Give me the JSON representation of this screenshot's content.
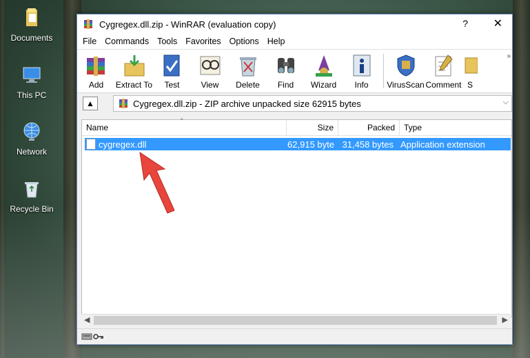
{
  "desktop": {
    "icons": [
      {
        "label": "Documents"
      },
      {
        "label": "This PC"
      },
      {
        "label": "Network"
      },
      {
        "label": "Recycle Bin"
      }
    ]
  },
  "window": {
    "title": "Cygregex.dll.zip - WinRAR (evaluation copy)",
    "help_label": "?",
    "close_label": "✕",
    "menu": [
      "File",
      "Commands",
      "Tools",
      "Favorites",
      "Options",
      "Help"
    ],
    "toolbar": [
      {
        "label": "Add",
        "icon": "add-icon"
      },
      {
        "label": "Extract To",
        "icon": "extract-icon"
      },
      {
        "label": "Test",
        "icon": "test-icon"
      },
      {
        "label": "View",
        "icon": "view-icon"
      },
      {
        "label": "Delete",
        "icon": "delete-icon"
      },
      {
        "label": "Find",
        "icon": "find-icon"
      },
      {
        "label": "Wizard",
        "icon": "wizard-icon"
      },
      {
        "label": "Info",
        "icon": "info-icon"
      },
      {
        "label": "VirusScan",
        "icon": "virusscan-icon"
      },
      {
        "label": "Comment",
        "icon": "comment-icon"
      },
      {
        "label": "S",
        "icon": "sfx-icon"
      }
    ],
    "toolbar_more": "»",
    "address": {
      "text": "Cygregex.dll.zip - ZIP archive unpacked size 62915 bytes",
      "up_label": "▲"
    },
    "columns": [
      "Name",
      "Size",
      "Packed",
      "Type"
    ],
    "rows": [
      {
        "name": "cygregex.dll",
        "size": "62,915 byte",
        "packed": "31,458 bytes",
        "type": "Application extension"
      }
    ],
    "colors": {
      "selection": "#3399ff",
      "accent": "#6b8fc0",
      "arrow": "#e8453c"
    }
  }
}
